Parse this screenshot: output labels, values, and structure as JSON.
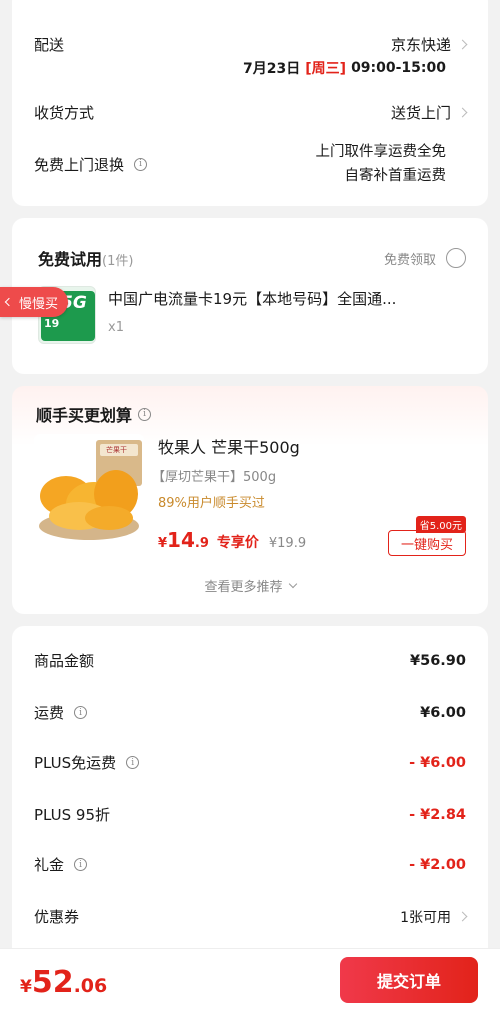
{
  "delivery": {
    "label": "配送",
    "carrier": "京东快递",
    "date": "7月23日",
    "weekday": "[周三]",
    "time": "09:00-15:00",
    "method_label": "收货方式",
    "method_value": "送货上门",
    "return_label": "免费上门退换",
    "return_line1": "上门取件享运费全免",
    "return_line2": "自寄补首重运费"
  },
  "trial": {
    "title": "免费试用",
    "count": "(1件)",
    "claim": "免费领取",
    "product": "中国广电流量卡19元【本地号码】全国通...",
    "qty": "x1",
    "thumb_text": "5G",
    "thumb_price": "19"
  },
  "floating_tab": {
    "label": "慢慢买"
  },
  "bundle": {
    "title": "顺手买更划算",
    "name": "牧果人 芒果干500g",
    "spec": "【厚切芒果干】500g",
    "stat": "89%用户顺手买过",
    "price_symbol": "¥",
    "price_int": "14",
    "price_dec": ".9",
    "price_tag": "专享价",
    "orig_price": "¥19.9",
    "save_badge": "省5.00元",
    "buy_btn": "一键购买",
    "more": "查看更多推荐",
    "bag_text": "芒果干"
  },
  "summary": {
    "rows": [
      {
        "label": "商品金额",
        "info": false,
        "value": "¥56.90",
        "red": false
      },
      {
        "label": "运费",
        "info": true,
        "value": "¥6.00",
        "red": false
      },
      {
        "label": "PLUS免运费",
        "info": true,
        "value": "- ¥6.00",
        "red": true
      },
      {
        "label": "PLUS 95折",
        "info": false,
        "value": "- ¥2.84",
        "red": true
      },
      {
        "label": "礼金",
        "info": true,
        "value": "- ¥2.00",
        "red": true
      }
    ],
    "coupon_label": "优惠券",
    "coupon_value": "1张可用"
  },
  "footer": {
    "symbol": "¥",
    "total_int": "52",
    "total_dec": ".06",
    "submit": "提交订单"
  },
  "colors": {
    "accent": "#e2231a",
    "background": "#f2f2f2",
    "gold": "#c98a2c"
  }
}
